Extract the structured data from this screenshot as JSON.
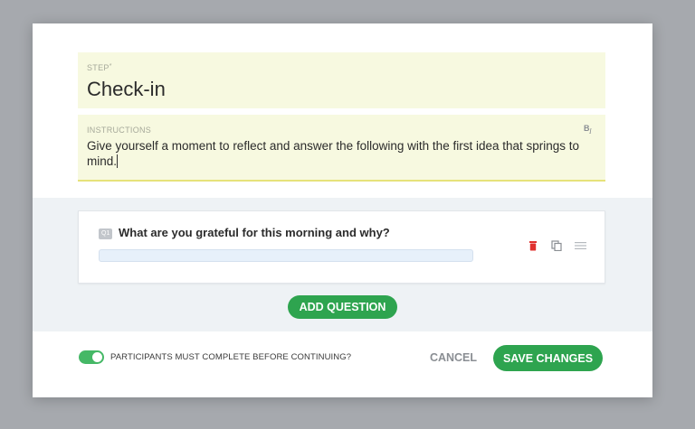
{
  "step": {
    "label": "STEP",
    "required_mark": "*",
    "value": "Check-in"
  },
  "instructions": {
    "label": "INSTRUCTIONS",
    "value": "Give yourself a moment to reflect and answer the following with the first idea that springs to mind.",
    "format_icon": "text-format-icon"
  },
  "questions": [
    {
      "badge": "Q1",
      "text": "What are you grateful for this morning and why?",
      "answer_placeholder": "",
      "actions": [
        "trash-icon",
        "copy-icon",
        "drag-handle-icon"
      ]
    }
  ],
  "add_question_label": "ADD QUESTION",
  "toggle": {
    "label": "PARTICIPANTS MUST COMPLETE BEFORE CONTINUING?",
    "on": true
  },
  "footer": {
    "cancel_label": "CANCEL",
    "save_label": "SAVE CHANGES"
  },
  "colors": {
    "accent_green": "#2ea44f",
    "field_background": "#f7f9e0",
    "delete_red": "#e0312f"
  }
}
